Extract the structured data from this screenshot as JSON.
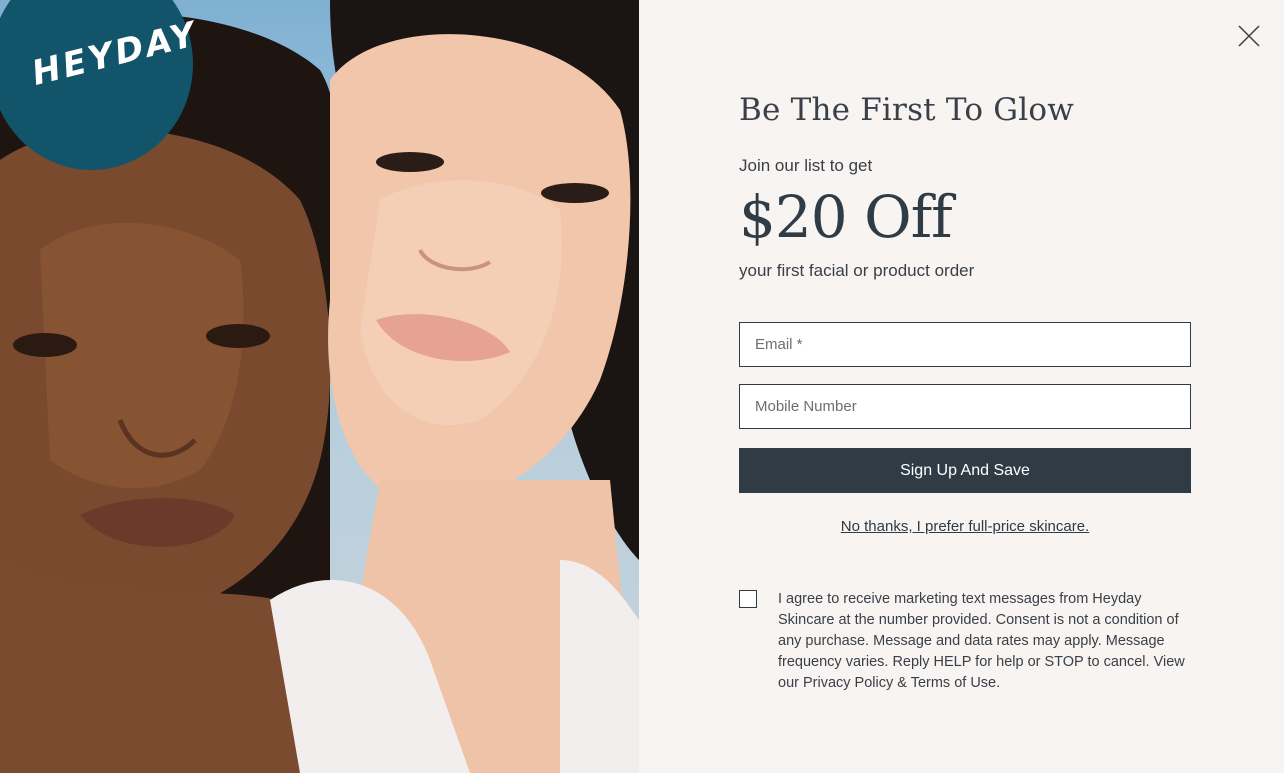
{
  "brand": {
    "logo_text": "HEYDAY",
    "logo_color": "#125469"
  },
  "modal": {
    "close_icon": "close-icon",
    "headline": "Be The First To Glow",
    "intro": "Join our list to get",
    "offer": "$20 Off",
    "subtext": "your first facial or product order",
    "email_placeholder": "Email *",
    "phone_placeholder": "Mobile Number",
    "submit_label": "Sign Up And Save",
    "decline_label": "No thanks, I prefer full-price skincare.",
    "consent_text": "I agree to receive marketing text messages from Heyday Skincare at the number provided. Consent is not a condition of any purchase. Message and data rates may apply. Message frequency varies. Reply HELP for help or STOP to cancel. View our Privacy Policy & Terms of Use.",
    "consent_checked": false
  },
  "colors": {
    "button_bg": "#2f3b45",
    "panel_bg": "#f7f4f1",
    "text": "#3a4049"
  }
}
